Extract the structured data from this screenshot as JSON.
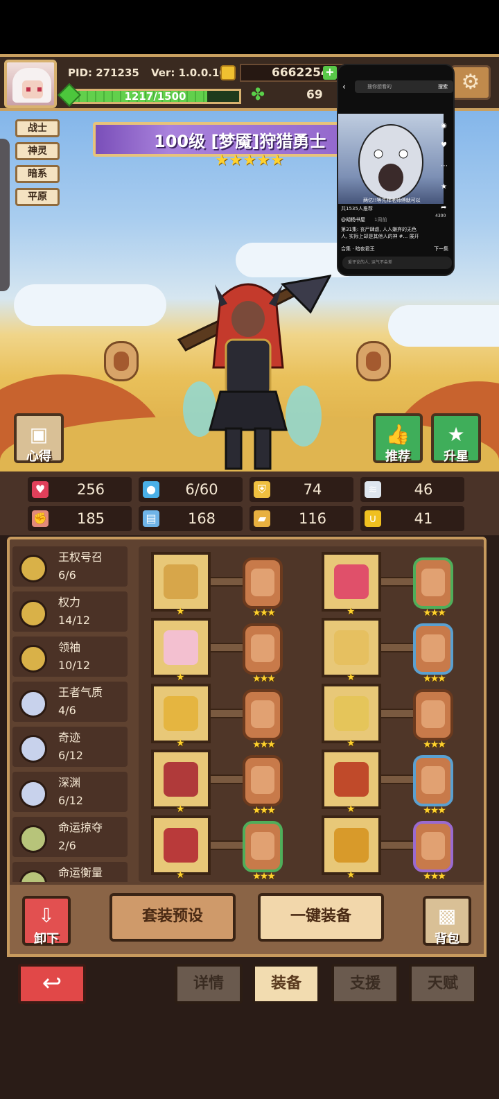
{
  "player": {
    "pid": "PID: 271235",
    "version": "Ver: 1.0.0.10",
    "coins": "6662254",
    "xp": "1217/1500",
    "xp_fraction": 0.811,
    "clover_count": "69"
  },
  "character": {
    "tags": [
      "战士",
      "神灵",
      "暗系",
      "平原"
    ],
    "name": "100级 [梦魇]狩猎勇士",
    "stars": 5
  },
  "scene_buttons": {
    "insight": "心得",
    "recommend": "推荐",
    "star_up": "升星"
  },
  "stats": [
    {
      "icon": "heart-icon",
      "value": "256",
      "color": "#e0405a"
    },
    {
      "icon": "water-drop-icon",
      "value": "6/60",
      "color": "#4ab0e8"
    },
    {
      "icon": "shield-icon",
      "value": "74",
      "color": "#f0c040"
    },
    {
      "icon": "wing-icon",
      "value": "46",
      "color": "#dfe6ef"
    },
    {
      "icon": "fist-icon",
      "value": "185",
      "color": "#e38a7a"
    },
    {
      "icon": "book-icon",
      "value": "168",
      "color": "#6fb4e8"
    },
    {
      "icon": "boot-icon",
      "value": "116",
      "color": "#e8b040"
    },
    {
      "icon": "horseshoe-icon",
      "value": "41",
      "color": "#f0c020"
    }
  ],
  "sets": [
    {
      "name": "王权号召",
      "count": "6/6",
      "color": "#d9b148"
    },
    {
      "name": "权力",
      "count": "14/12",
      "color": "#d9b148"
    },
    {
      "name": "领袖",
      "count": "10/12",
      "color": "#d9b148"
    },
    {
      "name": "王者气质",
      "count": "4/6",
      "color": "#c8d2ec"
    },
    {
      "name": "奇迹",
      "count": "6/12",
      "color": "#c8d2ec"
    },
    {
      "name": "深渊",
      "count": "6/12",
      "color": "#c8d2ec"
    },
    {
      "name": "命运掠夺",
      "count": "2/6",
      "color": "#b7c47a"
    },
    {
      "name": "命运衡量",
      "count": "",
      "color": "#b7c47a"
    }
  ],
  "actions": {
    "unequip": "卸下",
    "preset": "套装预设",
    "auto_equip": "一键装备",
    "bag": "背包"
  },
  "tabs": [
    "详情",
    "装备",
    "支援",
    "天赋"
  ],
  "overlay": {
    "search_placeholder": "搜你想看的",
    "search_button": "搜索",
    "caption": "两亿!!等先拜老师傅就可以",
    "comment_bar": "共1535人推荐",
    "author": "@胡杨书屋",
    "time": "1周前",
    "desc_line1": "第31集: 丧尸肆虐, 人人嫌弃的无色",
    "desc_line2": "人, 实际上却是其他人的神 #... 展开",
    "series": "合集 · 暗夜君王",
    "next": "下一集",
    "input_placeholder": "爱评论的人, 运气不会差",
    "likes": "4300"
  }
}
